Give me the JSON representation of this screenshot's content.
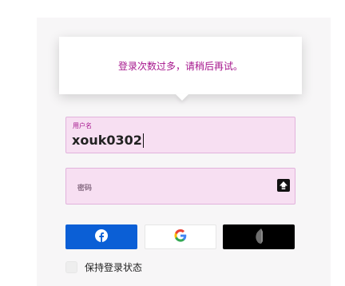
{
  "tooltip": {
    "message": "登录次数过多，请稍后再试。"
  },
  "username_field": {
    "label": "用户名",
    "value": "xouk0302"
  },
  "password_field": {
    "placeholder": "密码",
    "icon": "capslock-icon"
  },
  "social_buttons": {
    "facebook": {
      "icon": "facebook-icon",
      "color": "#0b5fd6"
    },
    "google": {
      "icon": "google-icon"
    },
    "apple": {
      "icon": "apple-icon",
      "color": "#000000"
    }
  },
  "remember": {
    "label": "保持登录状态",
    "checked": false
  },
  "colors": {
    "accent": "#a6168d",
    "field_bg": "#f7dff2",
    "field_border": "#e2b3dc"
  }
}
